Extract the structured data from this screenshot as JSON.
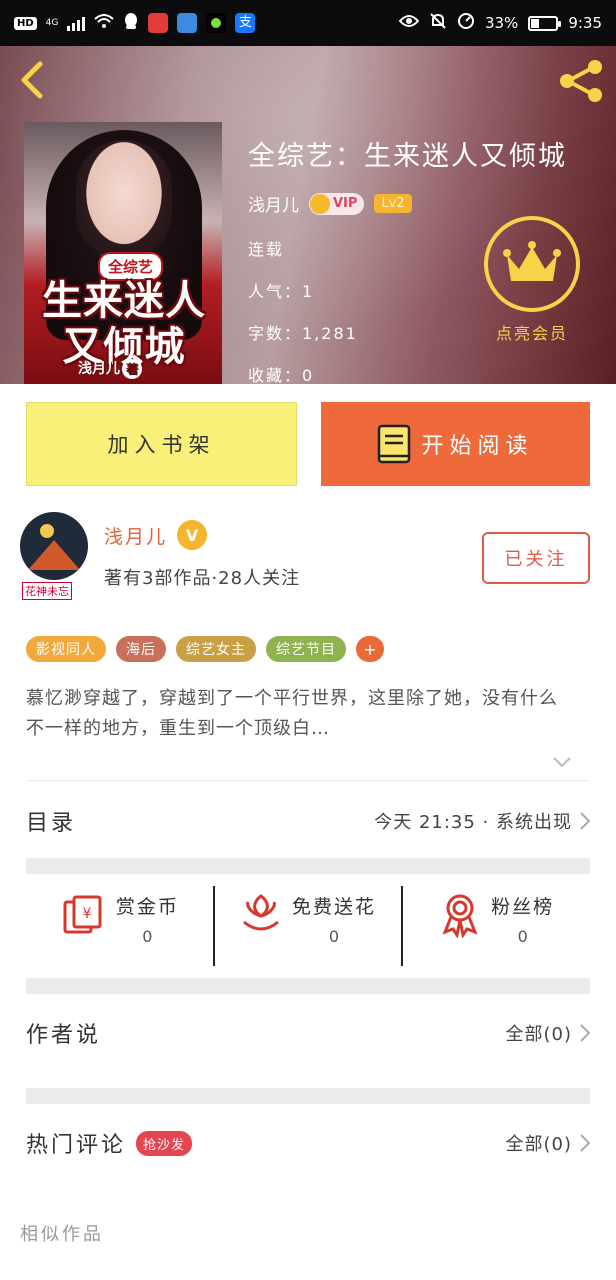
{
  "status_bar": {
    "hd": "HD",
    "network": "4G",
    "battery_percent": "33%",
    "battery_level": 0.33,
    "time": "9:35"
  },
  "book": {
    "title": "全综艺：生来迷人又倾城",
    "author": "浅月儿",
    "vip_label": "VIP",
    "level": "Lv2",
    "status": "连载",
    "popularity": "人气：1",
    "word_count": "字数：1,281",
    "favorites": "收藏：0",
    "cover": {
      "tag": "全综艺",
      "title": "生来迷人又倾城",
      "author": "浅月儿",
      "author_suffix": "著"
    }
  },
  "header": {
    "back_icon": "back-arrow-icon",
    "share_icon": "share-icon",
    "vip_button_label": "点亮会员",
    "accent_color": "#f7d34a"
  },
  "actions": {
    "add_to_shelf": "加入书架",
    "start_reading": "开始阅读"
  },
  "author_card": {
    "avatar_sign": "花神未忘",
    "name": "浅月儿",
    "verified_badge": "V",
    "subtitle": "著有3部作品·28人关注",
    "follow_label": "已关注"
  },
  "tags": [
    {
      "label": "影视同人",
      "color": "#f2a93b"
    },
    {
      "label": "海后",
      "color": "#c8705a"
    },
    {
      "label": "综艺女主",
      "color": "#c9a046"
    },
    {
      "label": "综艺节目",
      "color": "#8fb350"
    }
  ],
  "tag_more": "+",
  "description": "慕忆渺穿越了，穿越到了一个平行世界，这里除了她，没有什么不一样的地方，重生到一个顶级白…",
  "catalog": {
    "title": "目录",
    "latest": "今天 21:35 · 系统出现"
  },
  "stats": [
    {
      "label": "赏金币",
      "value": "0",
      "icon": "gold-coin-icon"
    },
    {
      "label": "免费送花",
      "value": "0",
      "icon": "flower-icon"
    },
    {
      "label": "粉丝榜",
      "value": "0",
      "icon": "medal-icon"
    }
  ],
  "author_says": {
    "title": "作者说",
    "all_label": "全部(0)"
  },
  "hot_comments": {
    "title": "热门评论",
    "badge": "抢沙发",
    "all_label": "全部(0)"
  },
  "similar_works": "相似作品"
}
